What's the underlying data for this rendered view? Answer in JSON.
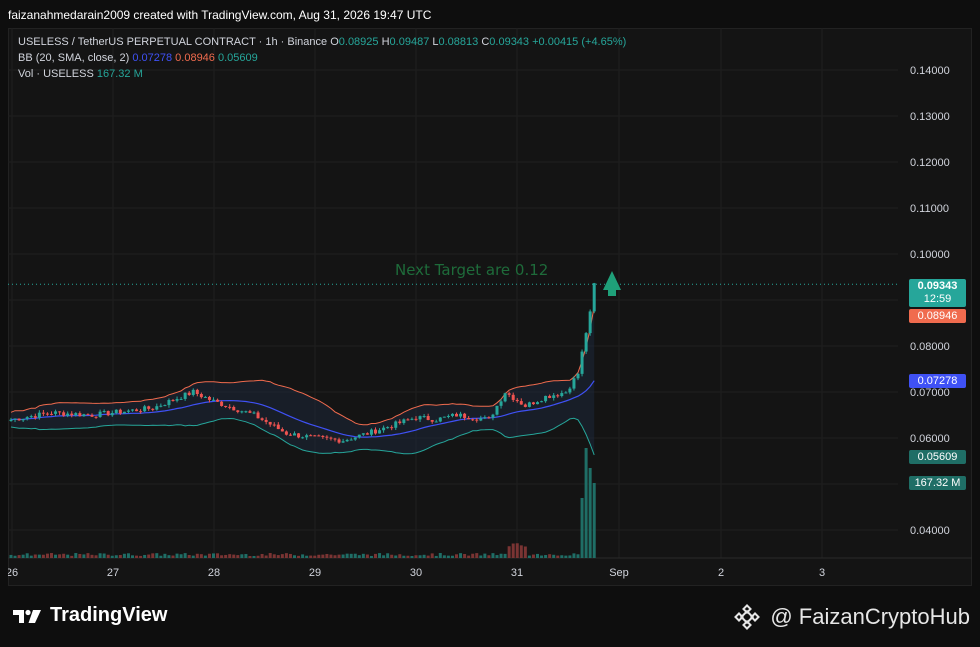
{
  "header": {
    "created_by": "faizanahmedarain2009 created with TradingView.com, Aug 31, 2026 19:47 UTC"
  },
  "legend": {
    "symbol_line": "USELESS / TetherUS PERPETUAL CONTRACT · 1h · Binance",
    "o_label": "O",
    "o_value": "0.08925",
    "h_label": "H",
    "h_value": "0.09487",
    "l_label": "L",
    "l_value": "0.08813",
    "c_label": "C",
    "c_value": "0.09343",
    "change": "+0.00415 (+4.65%)",
    "bb_label": "BB (20, SMA, close, 2)",
    "bb_basis": "0.07278",
    "bb_upper": "0.08946",
    "bb_lower": "0.05609",
    "vol_label": "Vol · USELESS",
    "vol_value": "167.32 M"
  },
  "annotation": {
    "text": "Next Target are 0.12",
    "color": "#1e6b3a"
  },
  "price_axis": {
    "ticks": [
      "0.14000",
      "0.13000",
      "0.12000",
      "0.11000",
      "0.10000",
      "0.08000",
      "0.07000",
      "0.06000",
      "0.04000"
    ],
    "tick_values": [
      0.14,
      0.13,
      0.12,
      0.11,
      0.1,
      0.08,
      0.07,
      0.06,
      0.04
    ]
  },
  "price_tags": {
    "last_price": "0.09343",
    "countdown": "12:59",
    "bb_upper": "0.08946",
    "bb_basis": "0.07278",
    "bb_lower": "0.05609",
    "volume": "167.32 M"
  },
  "time_axis": {
    "labels": [
      "26",
      "27",
      "28",
      "29",
      "30",
      "31",
      "Sep",
      "2",
      "3"
    ]
  },
  "colors": {
    "up": "#26a69a",
    "down": "#ef5350",
    "bb_basis": "#3f51f5",
    "bb_upper": "#f06b4e",
    "bb_lower": "#26a69a",
    "background": "#141414",
    "grid": "#1f1f1f"
  },
  "footer": {
    "brand": "TradingView",
    "handle": "@ FaizanCryptoHub",
    "left_icon": "tradingview-logo-icon",
    "right_icon": "binance-logo-icon"
  }
}
